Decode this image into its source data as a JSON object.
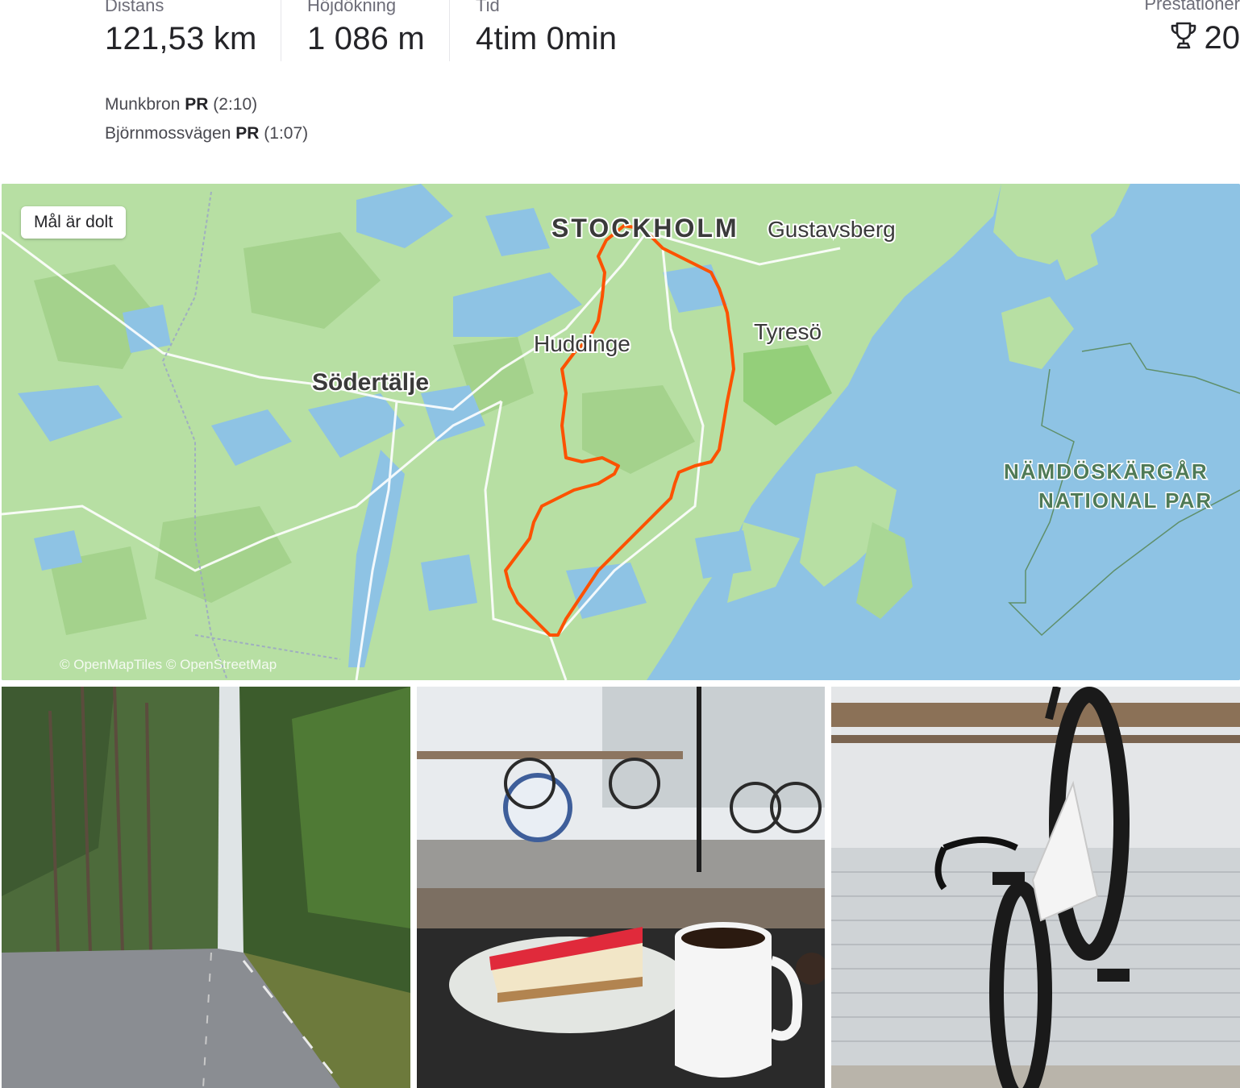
{
  "stats": {
    "distance": {
      "label": "Distans",
      "value": "121,53 km"
    },
    "elevation": {
      "label": "Höjdökning",
      "value": "1 086 m"
    },
    "time": {
      "label": "Tid",
      "value": "4tim 0min"
    }
  },
  "achievements": {
    "label": "Prestationer",
    "count": "20",
    "icon": "trophy-icon"
  },
  "segments": [
    {
      "name": "Munkbron",
      "badge": "PR",
      "time": "(2:10)"
    },
    {
      "name": "Björnmossvägen",
      "badge": "PR",
      "time": "(1:07)"
    }
  ],
  "map": {
    "badge": "Mål är dolt",
    "attribution": "© OpenMapTiles © OpenStreetMap",
    "labels": {
      "stockholm": "STOCKHOLM",
      "gustavsberg": "Gustavsberg",
      "huddinge": "Huddinge",
      "tyreso": "Tyresö",
      "sodertalje": "Södertälje",
      "park1": "NÄMDÖSKÄRGÅR",
      "park2": "NATIONAL PAR"
    },
    "colors": {
      "water": "#8ec3e4",
      "land": "#b7dfa3",
      "route": "#fc5200"
    }
  },
  "photos": [
    {
      "name": "forest-road-photo"
    },
    {
      "name": "cafe-cheesecake-photo"
    },
    {
      "name": "bike-hanging-photo"
    }
  ]
}
